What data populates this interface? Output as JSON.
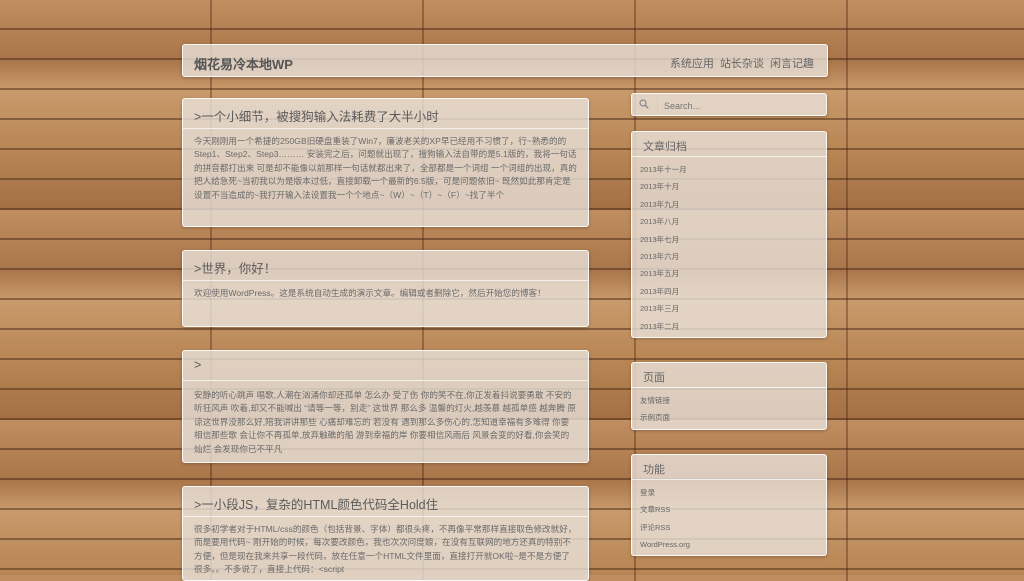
{
  "site": {
    "title": "烟花易冷本地WP",
    "nav": [
      "系统应用",
      "站长杂谈",
      "闲言记趣"
    ]
  },
  "posts": [
    {
      "title": ">一个小细节，被搜狗输入法耗费了大半小时",
      "body": "今天刚刚用一个希捷的250GB旧硬盘重装了Win7，廉波老关的XP早已经用不习惯了，行~熟悉的的Step1、Step2、Step3……… 安装完之后，问题就出现了，搜狗输入法自带的是5.1版的，我将一句话的拼音都打出来 可是却不能像以前那样一句话就都出来了，全部都是一个词组 一个词组的出现，真的把人给急死~当初我以为是版本过低，直接卸载一个最新的6.5版，可是问题依旧~ 既然如此那肯定是设置不当造成的~我打开输入法设置我一个个地点~（W）~（T）~（F）~找了半个"
    },
    {
      "title": ">世界，你好！",
      "body": "欢迎使用WordPress。这是系统自动生成的演示文章。编辑或者删除它，然后开始您的博客！"
    },
    {
      "title": ">",
      "body": "安静的听心跳声 唱歌,人潮在汹涌你却还孤单 怎么办 受了伤 你的笑不在,你正发着抖说要勇敢 不安的听狂风声 吹着,却又不能喊出 “请等一等，别走” 这世界 那么多 温馨的灯火,越羡慕 越孤单感 越奔腾 原谅这世界没那么好,陪我讲讲那些 心痛却难忘的 若没有 遇到那么多伤心的,怎知道幸福有多难得 你要相信那些歌 会让你不再孤单,放弃触礁的船 游到幸福的岸 你要相信风雨后 风景会变的好看,你会笑的灿烂 会发现你已不平凡"
    },
    {
      "title": ">一小段JS，复杂的HTML颜色代码全Hold住",
      "body": "很多初学者对于HTML/css的颜色（包括背景、字体）都很头疼，不再像平常那样直接取色修改就好，而是要用代码~ 刚开始的时候，每次要改颜色，我也次次问度娘，在没有互联网的地方还真的特别不方便，但是现在我来共享一段代码，放在任意一个HTML文件里面，直接打开就OK啦~是不是方便了很多。。不多说了，直接上代码：<script"
    }
  ],
  "search": {
    "placeholder": "Search..."
  },
  "widgets": {
    "archives": {
      "title": "文章归档",
      "items": [
        "2013年十一月",
        "2013年十月",
        "2013年九月",
        "2013年八月",
        "2013年七月",
        "2013年六月",
        "2013年五月",
        "2013年四月",
        "2013年三月",
        "2013年二月"
      ]
    },
    "pages": {
      "title": "页面",
      "items": [
        "友情链接",
        "示例页面"
      ]
    },
    "meta": {
      "title": "功能",
      "items": [
        "登录",
        "文章RSS",
        "评论RSS",
        "WordPress.org"
      ]
    }
  },
  "colors": {
    "panel_bg": "#ebe4de",
    "wood": "#b07c4f",
    "text": "#555555"
  },
  "icons": {
    "search": "magnifier-icon"
  }
}
